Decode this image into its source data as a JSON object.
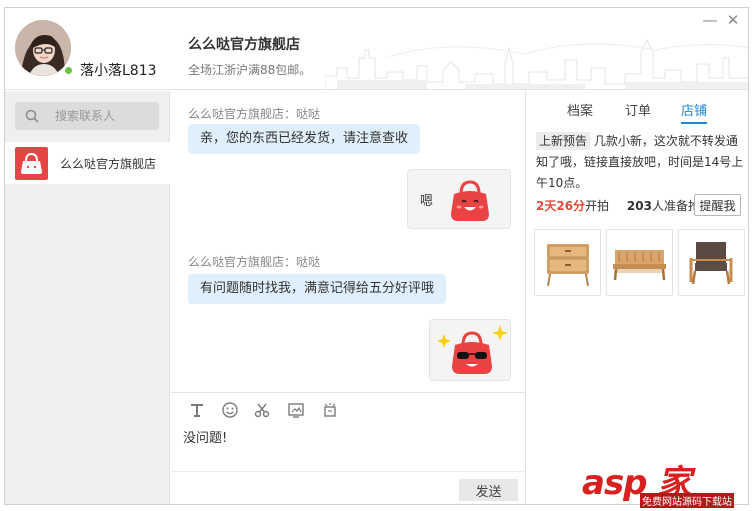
{
  "header": {
    "username": "落小落L813",
    "shop_title": "么么哒官方旗舰店",
    "shop_subtitle": "全场江浙沪满88包邮。",
    "minimize_label": "—",
    "close_label": "✕"
  },
  "sidebar": {
    "search_placeholder": "搜索联系人",
    "contacts": [
      {
        "name": "么么哒官方旗舰店"
      }
    ]
  },
  "chat": {
    "messages": [
      {
        "from": "shop",
        "sender": "么么哒官方旗舰店：哒哒",
        "text": "亲，您的东西已经发货，请注意查收"
      },
      {
        "from": "me",
        "text": "嗯",
        "sticker": "happy-bag-sticker"
      },
      {
        "from": "shop",
        "sender": "么么哒官方旗舰店：哒哒",
        "text": "有问题随时找我，满意记得给五分好评哦"
      },
      {
        "from": "me",
        "text": "",
        "sticker": "cool-bag-sticker"
      }
    ]
  },
  "compose": {
    "tools": [
      "text-format-icon",
      "emoji-icon",
      "scissors-icon",
      "image-icon",
      "shake-icon"
    ],
    "draft": "没问题!",
    "send_label": "发送"
  },
  "right_panel": {
    "tabs": [
      {
        "label": "档案",
        "active": false
      },
      {
        "label": "订单",
        "active": false
      },
      {
        "label": "店铺",
        "active": true
      }
    ],
    "notice_tag": "上新预告",
    "notice_text": "几款小新，这次就不转发通知了哦，链接直接放吧，时间是14号上午10点。",
    "countdown_days": "2天",
    "countdown_minutes": "26分",
    "countdown_suffix": "开拍",
    "waiting_count": "203",
    "waiting_suffix": "人准备抢",
    "remind_label": "提醒我",
    "products": [
      "wooden-nightstand",
      "wooden-bench",
      "armchair"
    ]
  },
  "watermark": {
    "brand": "asp 家",
    "tagline": "免费网站源码下载站"
  },
  "colors": {
    "accent_blue": "#1e88d8",
    "bubble_blue": "#dfeffb",
    "shop_red": "#e64545",
    "countdown_red": "#e24a3a",
    "online_green": "#6cc04a"
  }
}
